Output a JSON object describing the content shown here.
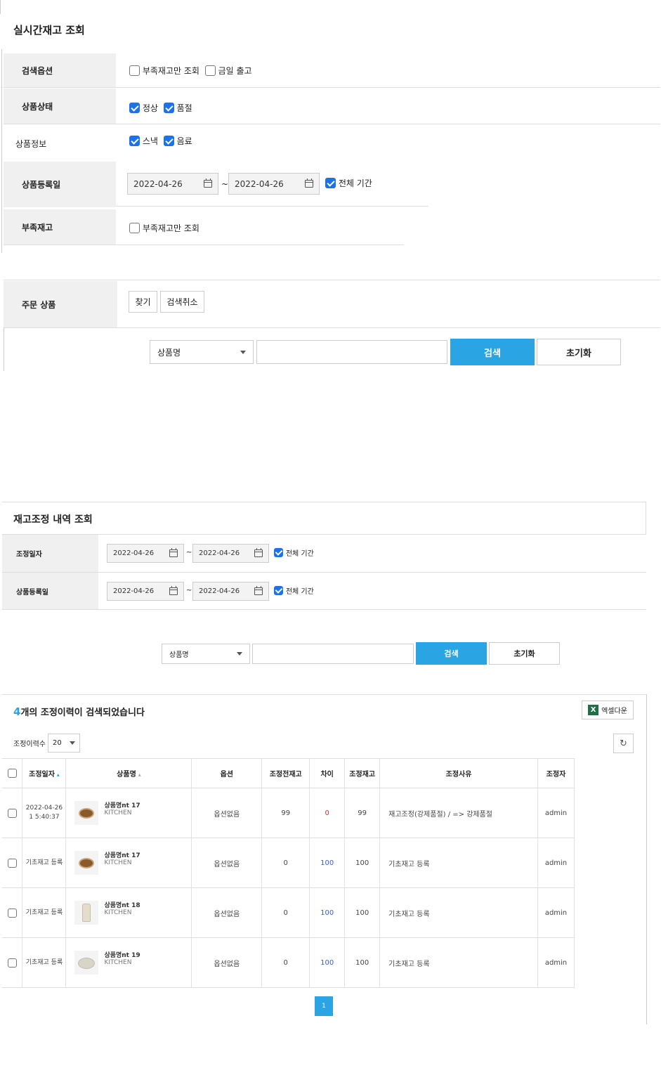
{
  "realtime": {
    "title": "실시간재고 조회",
    "search_option": {
      "label": "검색옵션",
      "opt1": "부족재고만 조회",
      "opt2": "금일 출고"
    },
    "status": {
      "label": "상품상태",
      "opt1": "정상",
      "opt2": "품절"
    },
    "info": {
      "label": "상품정보",
      "opt1": "스낵",
      "opt2": "음료"
    },
    "regdate": {
      "label": "상품등록일",
      "from": "2022-04-26",
      "to": "2022-04-26",
      "tilde": "~",
      "all": "전체 기간"
    },
    "shortage": {
      "label": "부족재고",
      "opt1": "부족재고만 조회"
    },
    "order": {
      "label": "주문 상품",
      "find": "찾기",
      "cancel": "검색취소"
    },
    "search": {
      "select": "상품명",
      "button": "검색",
      "reset": "초기화"
    }
  },
  "adjust": {
    "title": "재고조정 내역 조회",
    "adjdate": {
      "label": "조정일자",
      "from": "2022-04-26",
      "to": "2022-04-26",
      "tilde": "~",
      "all": "전체 기간"
    },
    "regdate": {
      "label": "상품등록일",
      "from": "2022-04-26",
      "to": "2022-04-26",
      "tilde": "~",
      "all": "전체 기간"
    },
    "search": {
      "select": "상품명",
      "button": "검색",
      "reset": "초기화"
    }
  },
  "results": {
    "count": "4",
    "count_text": "개의 조정이력이 검색되었습니다",
    "excel": "엑셀다운",
    "per_page_label": "조정이력수",
    "per_page": "20",
    "columns": [
      "조정일자",
      "상품명",
      "옵션",
      "조정전재고",
      "차이",
      "조정재고",
      "조정사유",
      "조정자"
    ],
    "rows": [
      {
        "date": "2022-04-26 1 5:40:37",
        "name": "상품명nt 17",
        "brand": "KITCHEN",
        "option": "옵션없음",
        "before": "99",
        "diff": "0",
        "after": "99",
        "reason": "재고조정(강제품절) / => 강제품절",
        "user": "admin",
        "thumb": "bowl"
      },
      {
        "date": "기초재고 등록",
        "name": "상품명nt 17",
        "brand": "KITCHEN",
        "option": "옵션없음",
        "before": "0",
        "diff": "100",
        "after": "100",
        "reason": "기초재고 등록",
        "user": "admin",
        "thumb": "bowl"
      },
      {
        "date": "기초재고 등록",
        "name": "상품명nt 18",
        "brand": "KITCHEN",
        "option": "옵션없음",
        "before": "0",
        "diff": "100",
        "after": "100",
        "reason": "기초재고 등록",
        "user": "admin",
        "thumb": "bottle"
      },
      {
        "date": "기초재고 등록",
        "name": "상품명nt 19",
        "brand": "KITCHEN",
        "option": "옵션없음",
        "before": "0",
        "diff": "100",
        "after": "100",
        "reason": "기초재고 등록",
        "user": "admin",
        "thumb": "plate"
      }
    ],
    "page": "1"
  }
}
